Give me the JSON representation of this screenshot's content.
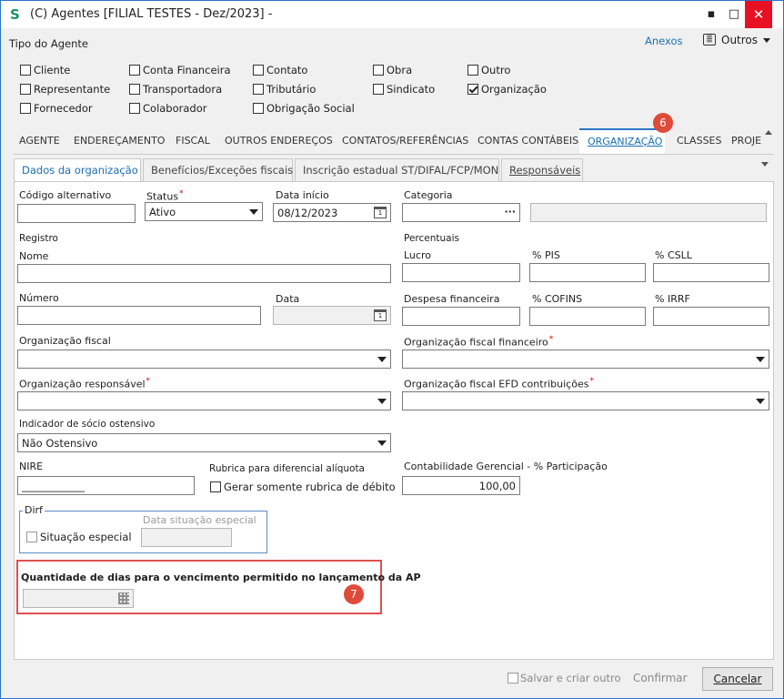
{
  "window": {
    "title": "(C) Agentes [FILIAL TESTES - Dez/2023]  -",
    "minimize": "▪",
    "maximize": "□",
    "close": "✕"
  },
  "header": {
    "tipo_label": "Tipo do Agente",
    "anexos": "Anexos",
    "outros": "Outros"
  },
  "agent_types": [
    {
      "label": "Cliente",
      "checked": false
    },
    {
      "label": "Conta Financeira",
      "checked": false
    },
    {
      "label": "Contato",
      "checked": false
    },
    {
      "label": "Obra",
      "checked": false
    },
    {
      "label": "Outro",
      "checked": false
    },
    {
      "label": "Representante",
      "checked": false
    },
    {
      "label": "Transportadora",
      "checked": false
    },
    {
      "label": "Tributário",
      "checked": false
    },
    {
      "label": "Sindicato",
      "checked": false
    },
    {
      "label": "Organização",
      "checked": true
    },
    {
      "label": "Fornecedor",
      "checked": false
    },
    {
      "label": "Colaborador",
      "checked": false
    },
    {
      "label": "Obrigação Social",
      "checked": false
    }
  ],
  "main_tabs": [
    "AGENTE",
    "ENDEREÇAMENTO",
    "FISCAL",
    "OUTROS ENDEREÇOS",
    "CONTATOS/REFERÊNCIAS",
    "CONTAS CONTÁBEIS",
    "ORGANIZAÇÃO",
    "CLASSES",
    "PROJE"
  ],
  "active_main_tab": "ORGANIZAÇÃO",
  "sub_tabs": [
    "Dados da organização",
    "Benefícios/Exceções fiscais",
    "Inscrição estadual ST/DIFAL/FCP/MON",
    "Responsáveis"
  ],
  "badges": {
    "tab": "6",
    "field": "7"
  },
  "form": {
    "codigo_alternativo": {
      "label": "Código alternativo",
      "value": ""
    },
    "status": {
      "label": "Status",
      "value": "Ativo"
    },
    "data_inicio": {
      "label": "Data início",
      "value": "08/12/2023"
    },
    "categoria": {
      "label": "Categoria",
      "value": "",
      "button": "···"
    },
    "registro_label": "Registro",
    "nome": {
      "label": "Nome",
      "value": ""
    },
    "numero": {
      "label": "Número",
      "value": ""
    },
    "data": {
      "label": "Data",
      "value": ""
    },
    "percentuais_label": "Percentuais",
    "lucro": {
      "label": "Lucro",
      "value": ""
    },
    "pis": {
      "label": "% PIS",
      "value": ""
    },
    "csll": {
      "label": "% CSLL",
      "value": ""
    },
    "despesa": {
      "label": "Despesa financeira",
      "value": ""
    },
    "cofins": {
      "label": "% COFINS",
      "value": ""
    },
    "irrf": {
      "label": "% IRRF",
      "value": ""
    },
    "org_fiscal": {
      "label": "Organização fiscal",
      "value": ""
    },
    "org_fiscal_fin": {
      "label": "Organização fiscal financeiro",
      "value": ""
    },
    "org_resp": {
      "label": "Organização responsável",
      "value": ""
    },
    "org_efd": {
      "label": "Organização fiscal EFD contribuições",
      "value": ""
    },
    "indicador": {
      "label": "Indicador de sócio ostensivo",
      "value": "Não Ostensivo"
    },
    "nire": {
      "label": "NIRE",
      "value": "____________"
    },
    "rubrica_label": "Rubrica para diferencial alíquota",
    "rubrica_check": "Gerar somente rubrica de débito",
    "contab_ger": {
      "label": "Contabilidade Gerencial - % Participação",
      "value": "100,00"
    },
    "dirf": {
      "legend": "Dirf",
      "situacao": "Situação especial",
      "data_label": "Data situação especial",
      "data_value": ""
    },
    "quantidade_dias": {
      "label": "Quantidade de dias para o vencimento permitido no lançamento da AP",
      "value": ""
    }
  },
  "footer": {
    "salvar_criar": "Salvar e criar outro",
    "confirmar": "Confirmar",
    "cancelar": "Cancelar"
  }
}
